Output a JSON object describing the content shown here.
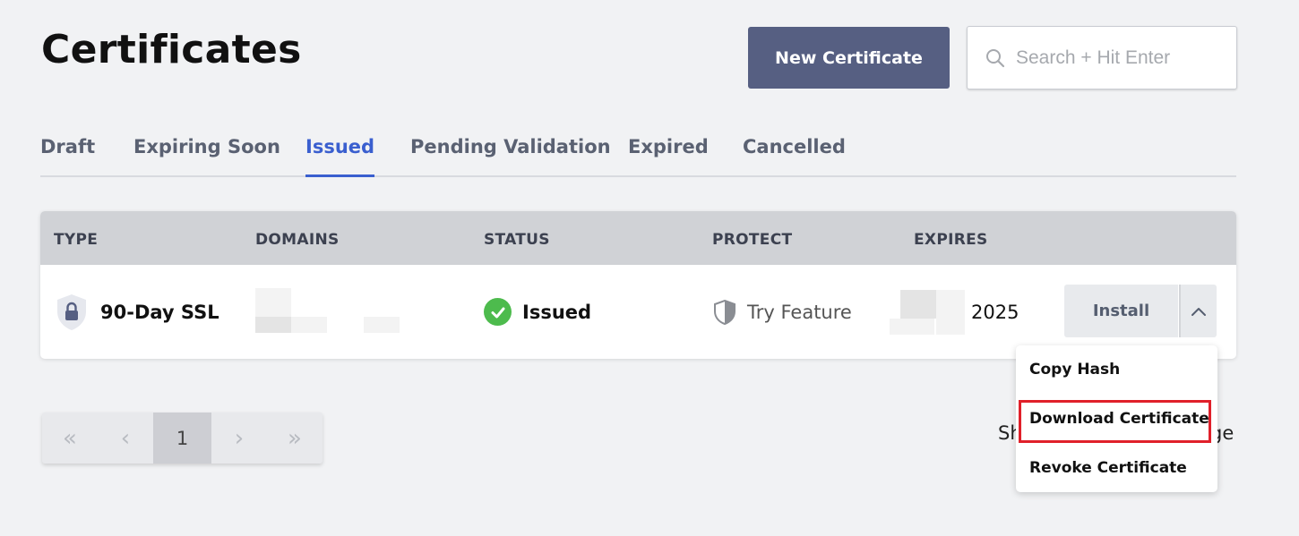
{
  "header": {
    "title": "Certificates",
    "new_button": "New Certificate",
    "search_placeholder": "Search + Hit Enter"
  },
  "tabs": [
    {
      "label": "Draft",
      "active": false
    },
    {
      "label": "Expiring Soon",
      "active": false
    },
    {
      "label": "Issued",
      "active": true
    },
    {
      "label": "Pending Validation",
      "active": false
    },
    {
      "label": "Expired",
      "active": false
    },
    {
      "label": "Cancelled",
      "active": false
    }
  ],
  "table": {
    "columns": [
      "TYPE",
      "DOMAINS",
      "STATUS",
      "PROTECT",
      "EXPIRES"
    ],
    "rows": [
      {
        "type": "90-Day SSL",
        "status": "Issued",
        "protect": "Try Feature",
        "expires": "2025",
        "install_label": "Install"
      }
    ]
  },
  "pagination": {
    "first": "«",
    "prev": "‹",
    "current": "1",
    "next": "›",
    "last": "»"
  },
  "footer_text": {
    "left_fragment": "Sh",
    "right_fragment": "ge"
  },
  "dropdown": {
    "items": [
      "Copy Hash",
      "Download Certificate",
      "Revoke Certificate"
    ],
    "highlighted_index": 1
  },
  "colors": {
    "primary": "#565f82",
    "active_tab": "#3a5fcf",
    "success": "#4dbb4d",
    "highlight": "#e0202a"
  }
}
